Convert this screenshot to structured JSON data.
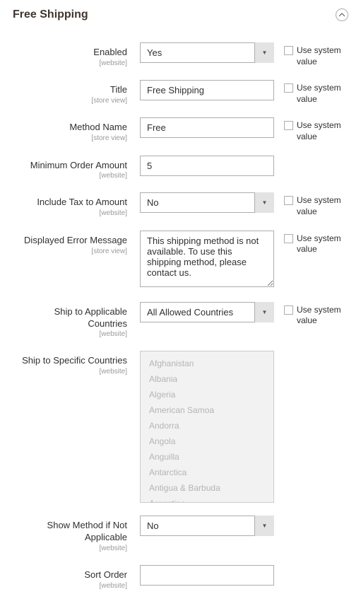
{
  "section": {
    "title": "Free Shipping"
  },
  "labels": {
    "use_system_value": "Use system value"
  },
  "scopes": {
    "website": "[website]",
    "store_view": "[store view]"
  },
  "fields": {
    "enabled": {
      "label": "Enabled",
      "value": "Yes"
    },
    "title": {
      "label": "Title",
      "value": "Free Shipping"
    },
    "method_name": {
      "label": "Method Name",
      "value": "Free"
    },
    "min_order": {
      "label": "Minimum Order Amount",
      "value": "5"
    },
    "include_tax": {
      "label": "Include Tax to Amount",
      "value": "No"
    },
    "error_msg": {
      "label": "Displayed Error Message",
      "value": "This shipping method is not available. To use this shipping method, please contact us."
    },
    "ship_applicable": {
      "label": "Ship to Applicable Countries",
      "value": "All Allowed Countries"
    },
    "ship_specific": {
      "label": "Ship to Specific Countries",
      "options": [
        "Afghanistan",
        "Albania",
        "Algeria",
        "American Samoa",
        "Andorra",
        "Angola",
        "Anguilla",
        "Antarctica",
        "Antigua & Barbuda",
        "Argentina"
      ]
    },
    "show_method": {
      "label": "Show Method if Not Applicable",
      "value": "No"
    },
    "sort_order": {
      "label": "Sort Order",
      "value": ""
    }
  }
}
